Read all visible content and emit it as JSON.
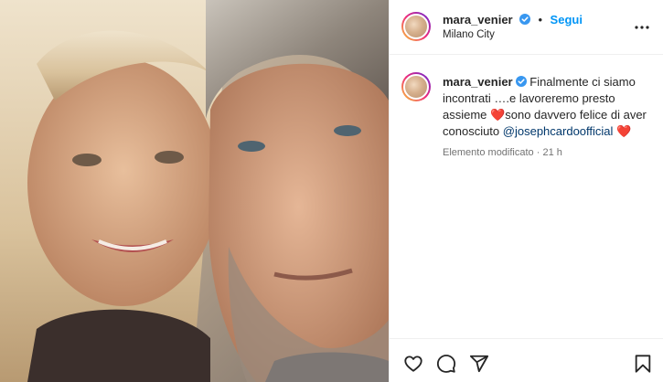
{
  "post": {
    "username": "mara_venier",
    "verified": true,
    "separator": "•",
    "follow_label": "Segui",
    "location": "Milano City"
  },
  "caption": {
    "username": "mara_venier",
    "text_part1": "Finalmente ci siamo incontrati ….e lavoreremo presto assieme",
    "emoji1": "❤️",
    "text_part2": "sono davvero felice di aver conosciuto",
    "mention": "@josephcardoofficial",
    "emoji2": "❤️"
  },
  "meta": {
    "edited": "Elemento modificato",
    "separator": "·",
    "time": "21 h"
  },
  "icons": {
    "more": "more-horizontal-icon",
    "like": "heart-outline-icon",
    "comment": "comment-bubble-icon",
    "share": "paper-plane-icon",
    "save": "bookmark-icon",
    "verified": "verified-badge-icon"
  },
  "colors": {
    "accent": "#0095f6",
    "verified": "#3897f0",
    "text": "#262626",
    "muted": "#737373",
    "mention": "#00376b"
  }
}
